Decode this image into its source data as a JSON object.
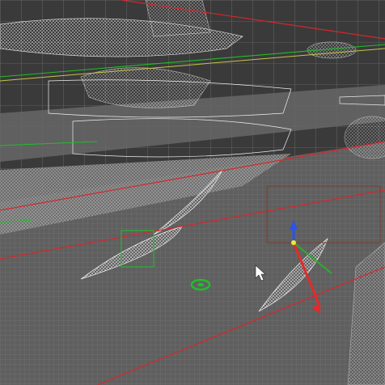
{
  "viewport": {
    "label": "",
    "shading_mode": "wireframe"
  },
  "colors": {
    "background": "#343434",
    "ground": "#5e5e5e",
    "wire": "#e8e8e8",
    "grid_red": "#d8262b",
    "grid_green": "#1fbf2a",
    "yellow_line": "#c8c24a",
    "gizmo_x": "#e42a2a",
    "gizmo_y": "#2ab02a",
    "gizmo_z": "#2a54e8",
    "gizmo_center": "#f0e63a",
    "selection_box": "#7a4030",
    "cursor": "#ffffff"
  },
  "icons": {
    "transform_gizmo": "move-gizmo-icon",
    "pointer": "mouse-cursor-icon",
    "pivot": "pivot-icon"
  }
}
